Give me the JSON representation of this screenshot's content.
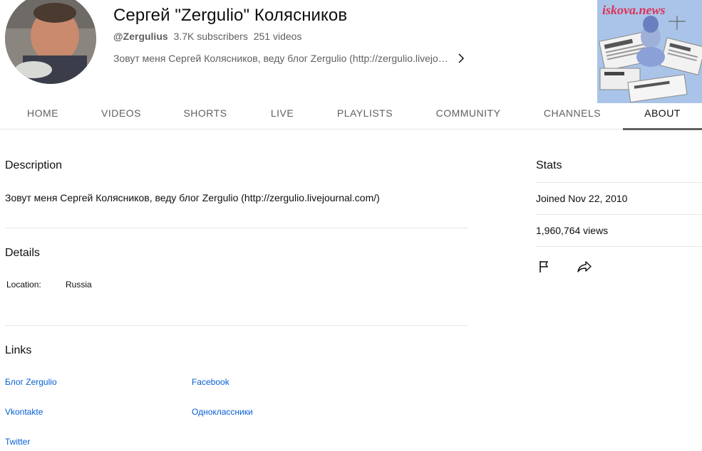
{
  "channel": {
    "title": "Сергей \"Zergulio\" Колясников",
    "handle": "@Zergulius",
    "subscribers": "3.7K subscribers",
    "videos": "251 videos",
    "description_preview": "Зовут меня Сергей Колясников, веду блог Zergulio (http://zergulio.livejo…"
  },
  "promo": {
    "title": "iskova.news"
  },
  "tabs": [
    {
      "label": "HOME"
    },
    {
      "label": "VIDEOS"
    },
    {
      "label": "SHORTS"
    },
    {
      "label": "LIVE"
    },
    {
      "label": "PLAYLISTS"
    },
    {
      "label": "COMMUNITY"
    },
    {
      "label": "CHANNELS"
    },
    {
      "label": "ABOUT"
    }
  ],
  "about": {
    "description_heading": "Description",
    "description_text": "Зовут меня Сергей Колясников, веду блог Zergulio (http://zergulio.livejournal.com/)",
    "details_heading": "Details",
    "location_label": "Location:",
    "location_value": "Russia",
    "links_heading": "Links",
    "links": [
      {
        "label": "Блог Zergulio"
      },
      {
        "label": "Facebook"
      },
      {
        "label": "Vkontakte"
      },
      {
        "label": "Одноклассники"
      },
      {
        "label": "Twitter"
      }
    ]
  },
  "stats": {
    "heading": "Stats",
    "joined": "Joined Nov 22, 2010",
    "views": "1,960,764 views"
  },
  "icons": {
    "chevron": "chevron-right-icon",
    "report": "flag-icon",
    "share": "share-icon"
  }
}
